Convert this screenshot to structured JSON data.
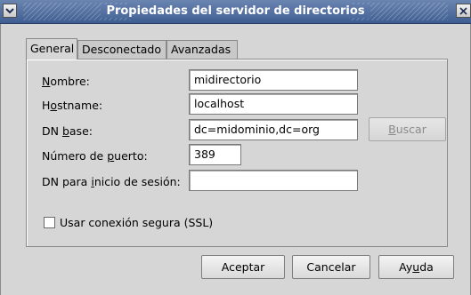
{
  "window": {
    "title": "Propiedades del servidor de directorios",
    "menu_icon": "chevron-down-icon",
    "close_icon": "close-icon"
  },
  "tabs": [
    {
      "label": "General",
      "active": true
    },
    {
      "label": "Desconectado",
      "active": false
    },
    {
      "label": "Avanzadas",
      "active": false
    }
  ],
  "form": {
    "nombre": {
      "label_pre": "",
      "label_mn": "N",
      "label_post": "ombre:",
      "value": "midirectorio"
    },
    "hostname": {
      "label_pre": "H",
      "label_mn": "o",
      "label_post": "stname:",
      "value": "localhost"
    },
    "dn_base": {
      "label_pre": "DN ",
      "label_mn": "b",
      "label_post": "ase:",
      "value": "dc=midominio,dc=org"
    },
    "puerto": {
      "label_pre": "Número de ",
      "label_mn": "p",
      "label_post": "uerto:",
      "value": "389"
    },
    "dn_login": {
      "label_pre": "DN para ",
      "label_mn": "i",
      "label_post": "nicio de sesión:",
      "value": ""
    },
    "buscar": {
      "pre": "",
      "mn": "B",
      "post": "uscar"
    },
    "ssl": {
      "label": "Usar conexión segura (SSL)",
      "checked": false
    }
  },
  "buttons": {
    "aceptar": "Aceptar",
    "cancelar": "Cancelar",
    "ayuda_pre": "Ay",
    "ayuda_mn": "u",
    "ayuda_post": "da"
  }
}
